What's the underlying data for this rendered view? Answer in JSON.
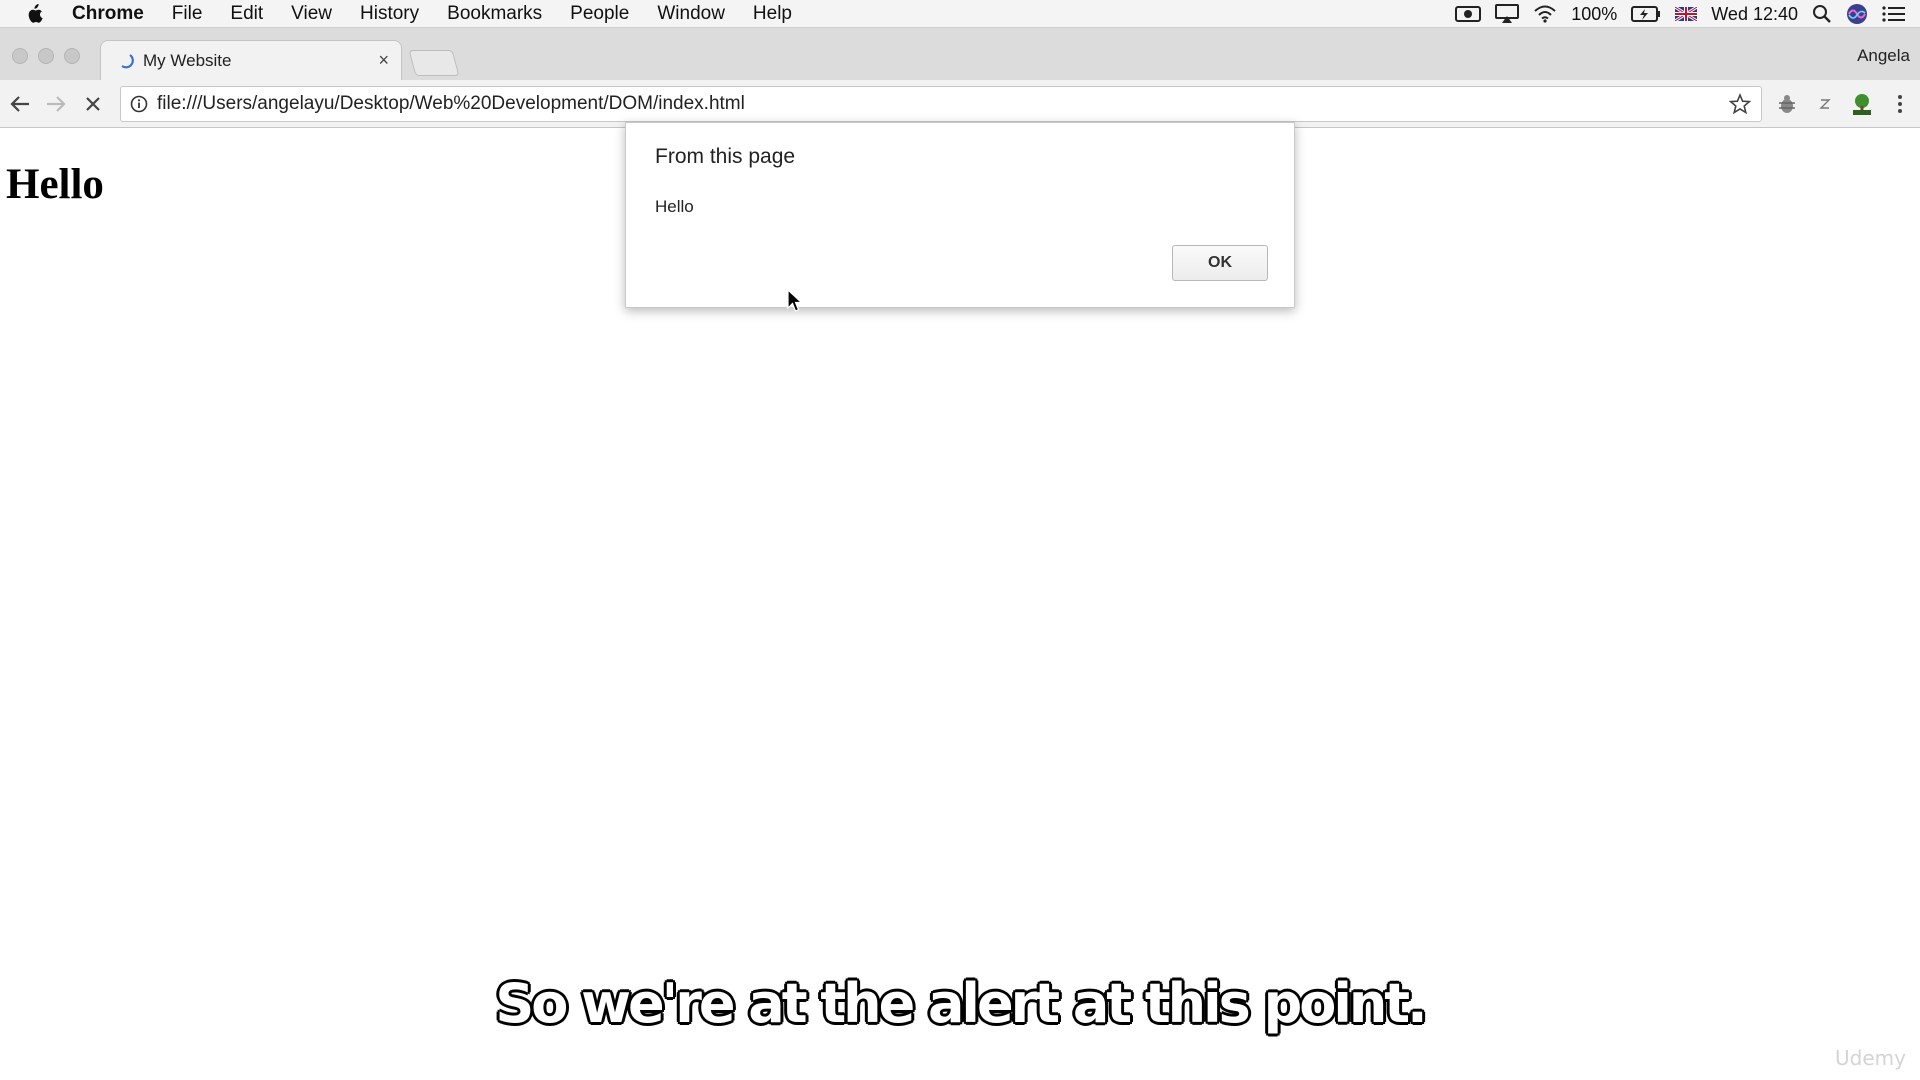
{
  "menubar": {
    "app_name": "Chrome",
    "items": [
      "File",
      "Edit",
      "View",
      "History",
      "Bookmarks",
      "People",
      "Window",
      "Help"
    ],
    "battery": "100%",
    "clock": "Wed 12:40",
    "icons": [
      "apple-icon",
      "camera-icon",
      "airplay-icon",
      "wifi-icon",
      "battery-icon",
      "uk-flag-icon",
      "search-icon",
      "siri-icon",
      "list-icon"
    ]
  },
  "tabstrip": {
    "tab_title": "My Website",
    "close_glyph": "×",
    "profile_name": "Angela"
  },
  "toolbar": {
    "url": "file:///Users/angelayu/Desktop/Web%20Development/DOM/index.html"
  },
  "page": {
    "heading": "Hello"
  },
  "alert": {
    "title": "From this page",
    "message": "Hello",
    "ok_label": "OK"
  },
  "overlay": {
    "subtitle": "So we're at the alert at this point.",
    "watermark": "Udemy"
  },
  "colors": {
    "menubar_bg": "#f4f4f4",
    "tabstrip_bg": "#dcdcdc",
    "toolbar_bg": "#f2f2f2",
    "spinner_accent": "#3b6fd6"
  }
}
